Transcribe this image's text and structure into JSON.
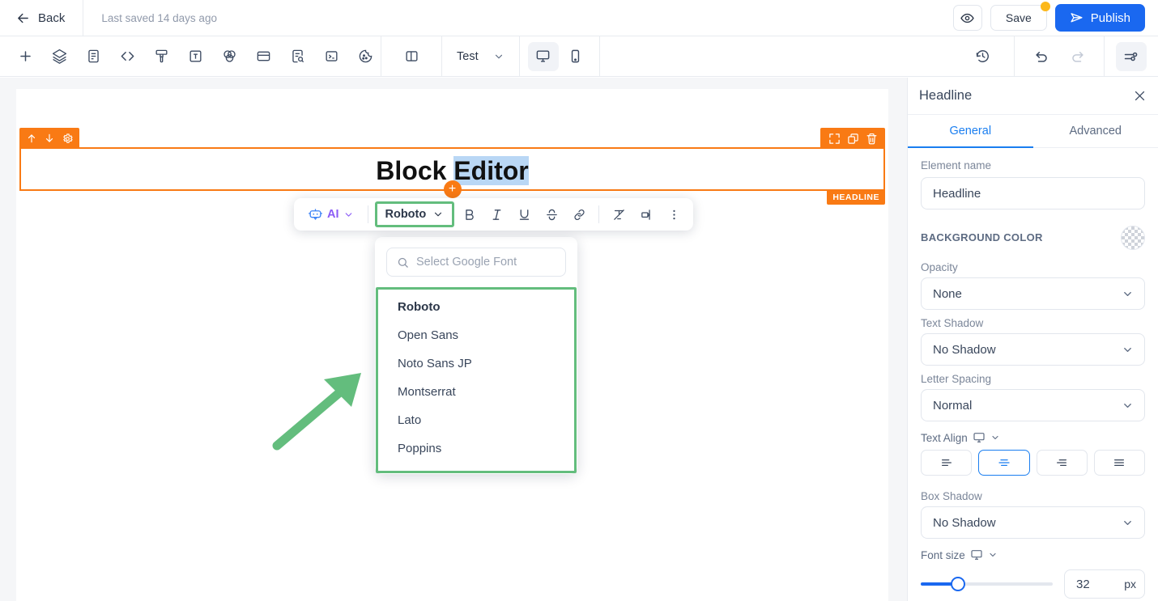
{
  "topbar": {
    "back_label": "Back",
    "saved_text": "Last saved 14 days ago",
    "preview_icon": "eye-icon",
    "save_label": "Save",
    "publish_label": "Publish",
    "publish_icon": "paper-plane-icon",
    "accent_blue": "#1a68f0",
    "badge_color": "#fcb81a"
  },
  "toolbar": {
    "left_icons": [
      "plus-icon",
      "layers-icon",
      "document-icon",
      "code-icon",
      "brush-icon",
      "text-box-icon",
      "color-blend-icon",
      "card-icon",
      "form-search-icon",
      "terminal-icon",
      "cookie-palette-icon"
    ],
    "panel_icon": "split-panel-icon",
    "test_label": "Test",
    "devices": [
      {
        "name": "desktop-view",
        "active": true
      },
      {
        "name": "mobile-view",
        "active": false
      }
    ],
    "history_icon": "history-clock-icon",
    "undo_icon": "undo-icon",
    "redo_icon": "redo-icon",
    "settings_icon": "settings-sliders-icon"
  },
  "canvas": {
    "block": {
      "label": "HEADLINE",
      "accent": "#f97a14",
      "text_before": "Block ",
      "text_selected": "Editor",
      "left_icons": [
        "move-up-icon",
        "move-down-icon",
        "gear-icon"
      ],
      "right_icons": [
        "expand-icon",
        "duplicate-icon",
        "trash-icon"
      ],
      "add_button": "+"
    }
  },
  "format_toolbar": {
    "ai_label": "AI",
    "ai_icon": "robot-icon",
    "font_value": "Roboto",
    "buttons": [
      {
        "name": "bold-button",
        "glyph": "B"
      },
      {
        "name": "italic-button",
        "glyph": "I"
      },
      {
        "name": "underline-button",
        "glyph": "U"
      },
      {
        "name": "strikethrough-button",
        "glyph": "S"
      },
      {
        "name": "link-button",
        "glyph": "link-icon"
      },
      {
        "name": "clear-format-button",
        "glyph": "clear-format-icon"
      },
      {
        "name": "text-direction-button",
        "glyph": "text-direction-icon"
      },
      {
        "name": "more-options-button",
        "glyph": "vertical-dots-icon"
      }
    ],
    "highlight_color": "#63bd7d"
  },
  "font_dropdown": {
    "search_placeholder": "Select Google Font",
    "search_value": "",
    "search_icon": "search-icon",
    "fonts": [
      {
        "label": "Roboto",
        "selected": true
      },
      {
        "label": "Open Sans",
        "selected": false
      },
      {
        "label": "Noto Sans JP",
        "selected": false
      },
      {
        "label": "Montserrat",
        "selected": false
      },
      {
        "label": "Lato",
        "selected": false
      },
      {
        "label": "Poppins",
        "selected": false
      }
    ]
  },
  "annotation": {
    "arrow_color": "#63bd7d"
  },
  "panel": {
    "title": "Headline",
    "close_icon": "close-icon",
    "tabs": [
      {
        "label": "General",
        "active": true
      },
      {
        "label": "Advanced",
        "active": false
      }
    ],
    "element_name_label": "Element name",
    "element_name_value": "Headline",
    "background_color_label": "BACKGROUND COLOR",
    "background_swatch": "transparent-checkerboard",
    "fields": [
      {
        "label": "Opacity",
        "value": "None"
      },
      {
        "label": "Text Shadow",
        "value": "No Shadow"
      },
      {
        "label": "Letter Spacing",
        "value": "Normal"
      }
    ],
    "text_align": {
      "label": "Text Align",
      "device_icon": "desktop-icon",
      "options": [
        {
          "name": "align-left",
          "active": false
        },
        {
          "name": "align-center",
          "active": true
        },
        {
          "name": "align-right",
          "active": false
        },
        {
          "name": "align-justify",
          "active": false
        }
      ]
    },
    "box_shadow": {
      "label": "Box Shadow",
      "value": "No Shadow"
    },
    "font_size": {
      "label": "Font size",
      "device_icon": "desktop-icon",
      "value": "32",
      "unit": "px",
      "percent": 28
    }
  }
}
